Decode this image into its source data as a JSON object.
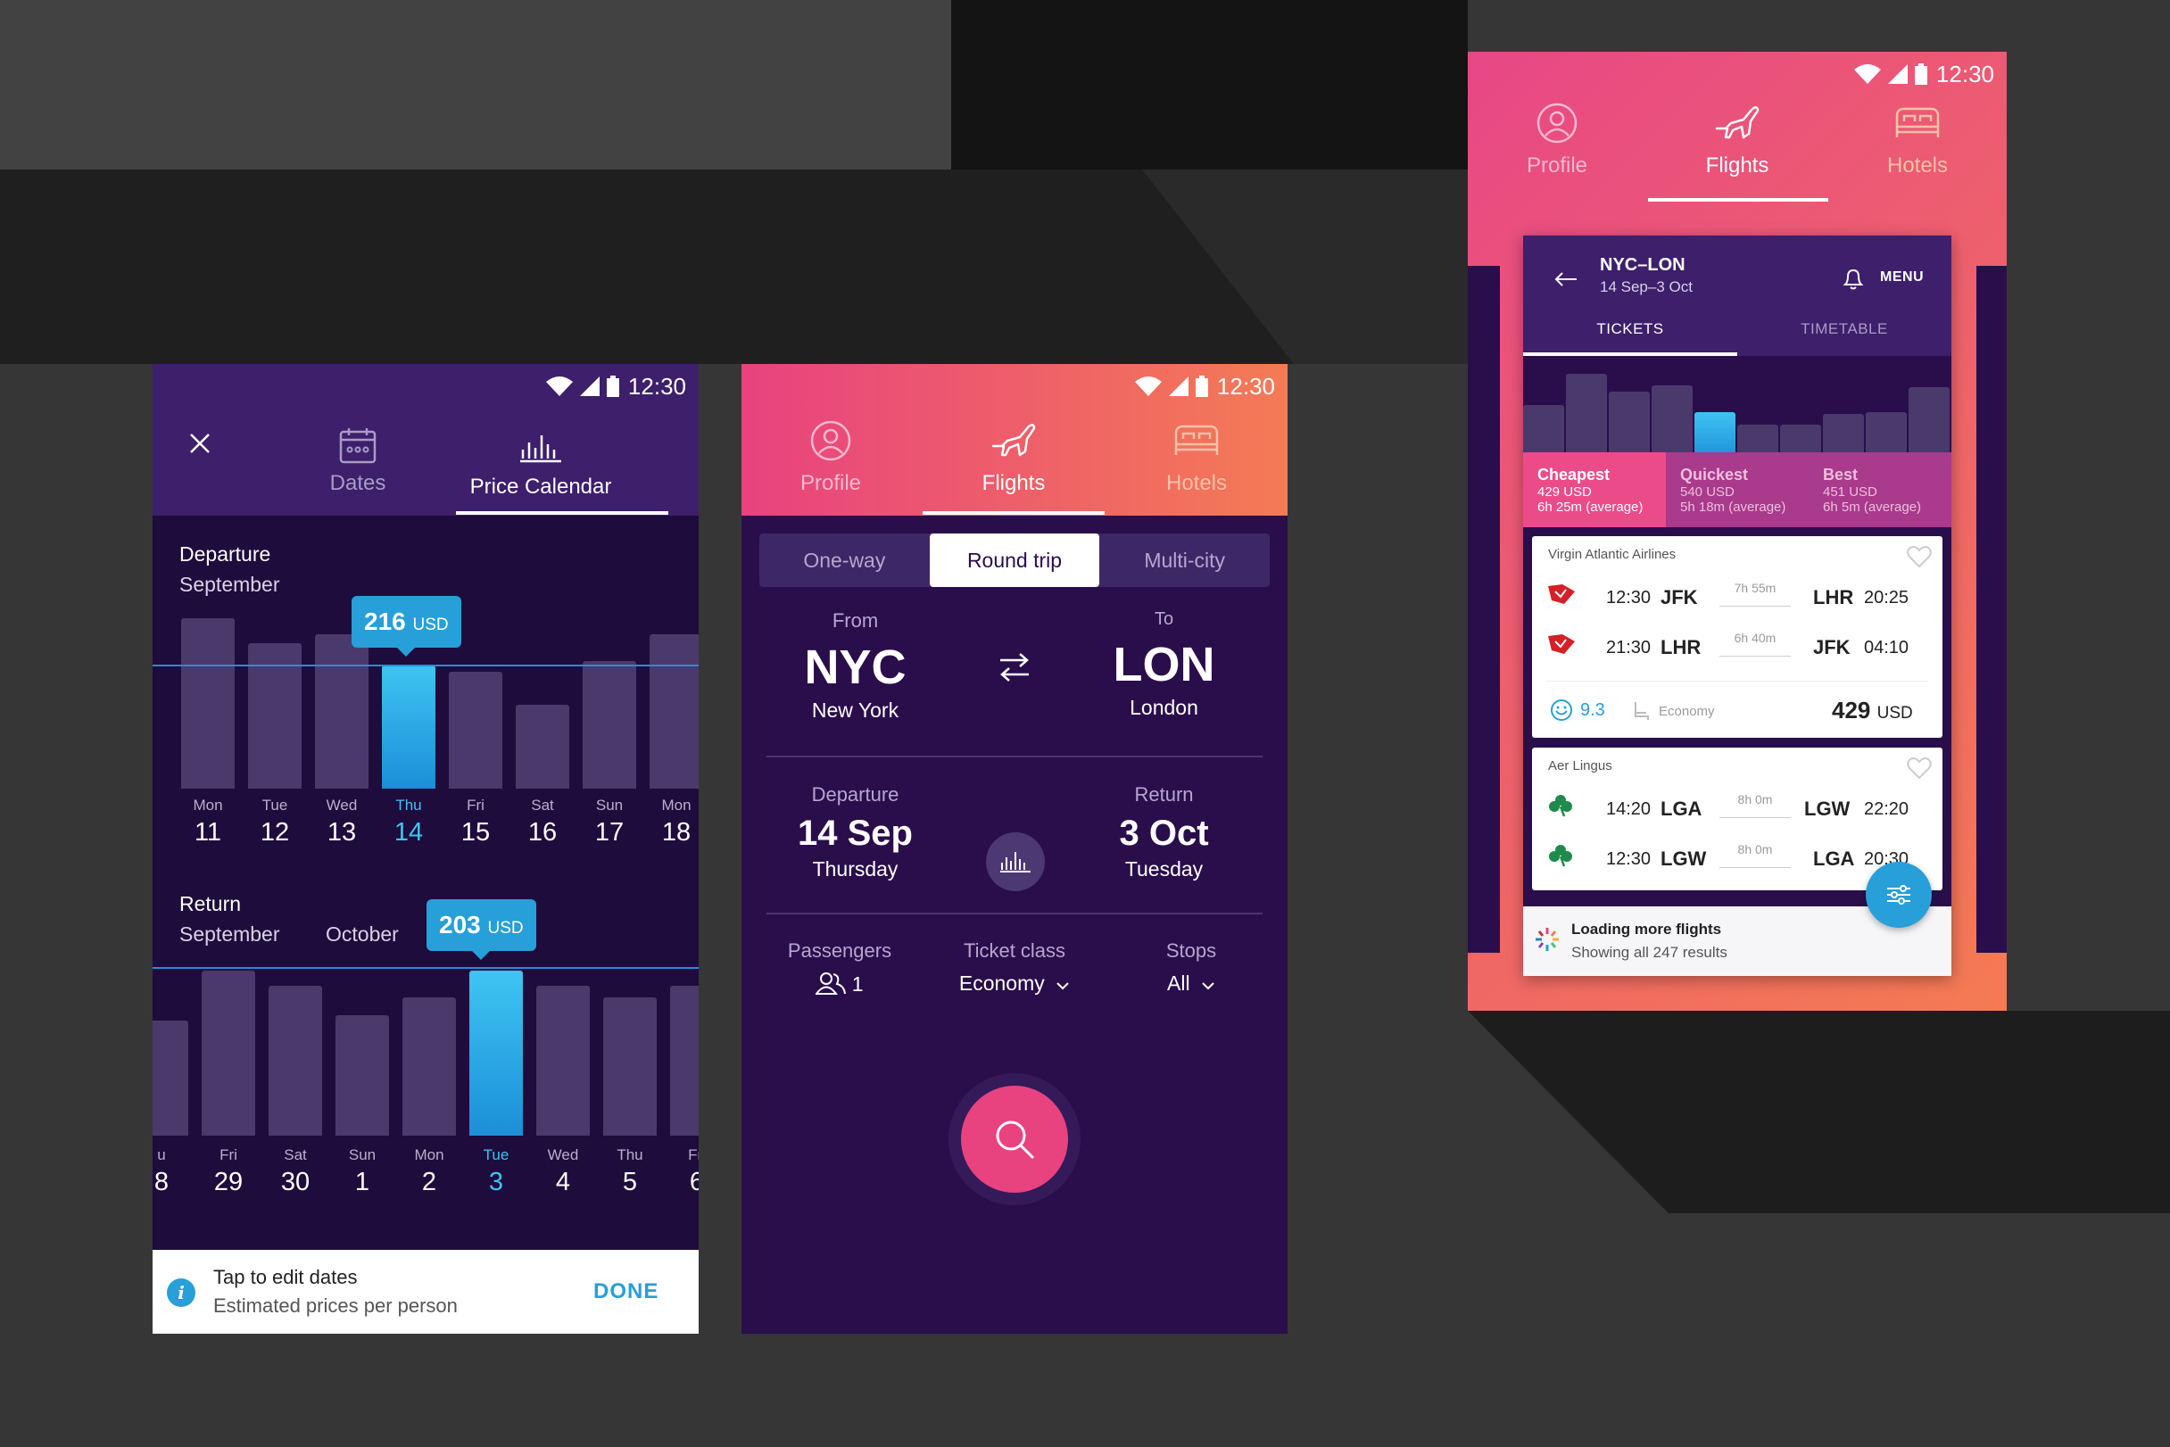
{
  "status": {
    "time": "12:30"
  },
  "calendar": {
    "tabs": {
      "dates": "Dates",
      "price_calendar": "Price Calendar"
    },
    "departure": {
      "title": "Departure",
      "month": "September",
      "tooltip_value": "216",
      "tooltip_unit": "USD",
      "days": [
        {
          "dow": "Mon",
          "day": "11"
        },
        {
          "dow": "Tue",
          "day": "12"
        },
        {
          "dow": "Wed",
          "day": "13"
        },
        {
          "dow": "Thu",
          "day": "14"
        },
        {
          "dow": "Fri",
          "day": "15"
        },
        {
          "dow": "Sat",
          "day": "16"
        },
        {
          "dow": "Sun",
          "day": "17"
        },
        {
          "dow": "Mon",
          "day": "18"
        }
      ],
      "bar_levels": [
        0.83,
        0.71,
        0.75,
        0.6,
        0.57,
        0.41,
        0.62,
        0.75
      ],
      "selected_index": 3
    },
    "return": {
      "title": "Return",
      "month1": "September",
      "month2": "October",
      "tooltip_value": "203",
      "tooltip_unit": "USD",
      "days": [
        {
          "dow": "u",
          "day": "8"
        },
        {
          "dow": "Fri",
          "day": "29"
        },
        {
          "dow": "Sat",
          "day": "30"
        },
        {
          "dow": "Sun",
          "day": "1"
        },
        {
          "dow": "Mon",
          "day": "2"
        },
        {
          "dow": "Tue",
          "day": "3"
        },
        {
          "dow": "Wed",
          "day": "4"
        },
        {
          "dow": "Thu",
          "day": "5"
        },
        {
          "dow": "Fri",
          "day": "6"
        }
      ],
      "bar_levels": [
        0.6,
        0.86,
        0.78,
        0.63,
        0.72,
        0.86,
        0.78,
        0.72,
        0.78
      ],
      "selected_index": 5
    },
    "footer": {
      "title": "Tap to edit dates",
      "subtitle": "Estimated prices per person",
      "done": "DONE"
    }
  },
  "search": {
    "tabs": {
      "profile": "Profile",
      "flights": "Flights",
      "hotels": "Hotels"
    },
    "trip_types": [
      "One-way",
      "Round trip",
      "Multi-city"
    ],
    "from": {
      "label": "From",
      "code": "NYC",
      "city": "New York"
    },
    "to": {
      "label": "To",
      "code": "LON",
      "city": "London"
    },
    "departure": {
      "label": "Departure",
      "date": "14 Sep",
      "weekday": "Thursday"
    },
    "return": {
      "label": "Return",
      "date": "3 Oct",
      "weekday": "Tuesday"
    },
    "passengers": {
      "label": "Passengers",
      "value": "1"
    },
    "ticket_class": {
      "label": "Ticket class",
      "value": "Economy"
    },
    "stops": {
      "label": "Stops",
      "value": "All"
    }
  },
  "results": {
    "tabs": {
      "profile": "Profile",
      "flights": "Flights",
      "hotels": "Hotels"
    },
    "route": "NYC–LON",
    "dates": "14 Sep–3 Oct",
    "menu": "MENU",
    "subtabs": [
      "TICKETS",
      "TIMETABLE"
    ],
    "mini_bar_levels": [
      0.6,
      0.95,
      0.75,
      0.82,
      0.52,
      0.38,
      0.38,
      0.5,
      0.52,
      0.8
    ],
    "mini_selected_index": 4,
    "sort": [
      {
        "label": "Cheapest",
        "price": "429 USD",
        "time": "6h 25m (average)"
      },
      {
        "label": "Quickest",
        "price": "540 USD",
        "time": "5h 18m (average)"
      },
      {
        "label": "Best",
        "price": "451 USD",
        "time": "6h 5m (average)"
      }
    ],
    "flights": [
      {
        "airline": "Virgin Atlantic Airlines",
        "legs": [
          {
            "dep_time": "12:30",
            "dep": "JFK",
            "duration": "7h 55m",
            "arr": "LHR",
            "arr_time": "20:25"
          },
          {
            "dep_time": "21:30",
            "dep": "LHR",
            "duration": "6h 40m",
            "arr": "JFK",
            "arr_time": "04:10"
          }
        ],
        "rating": "9.3",
        "class": "Economy",
        "price": "429",
        "currency": "USD"
      },
      {
        "airline": "Aer Lingus",
        "legs": [
          {
            "dep_time": "14:20",
            "dep": "LGA",
            "duration": "8h 0m",
            "arr": "LGW",
            "arr_time": "22:20"
          },
          {
            "dep_time": "12:30",
            "dep": "LGW",
            "duration": "8h 0m",
            "arr": "LGA",
            "arr_time": "20:30"
          }
        ]
      }
    ],
    "loading": {
      "title": "Loading more flights",
      "subtitle": "Showing all 247 results"
    }
  }
}
